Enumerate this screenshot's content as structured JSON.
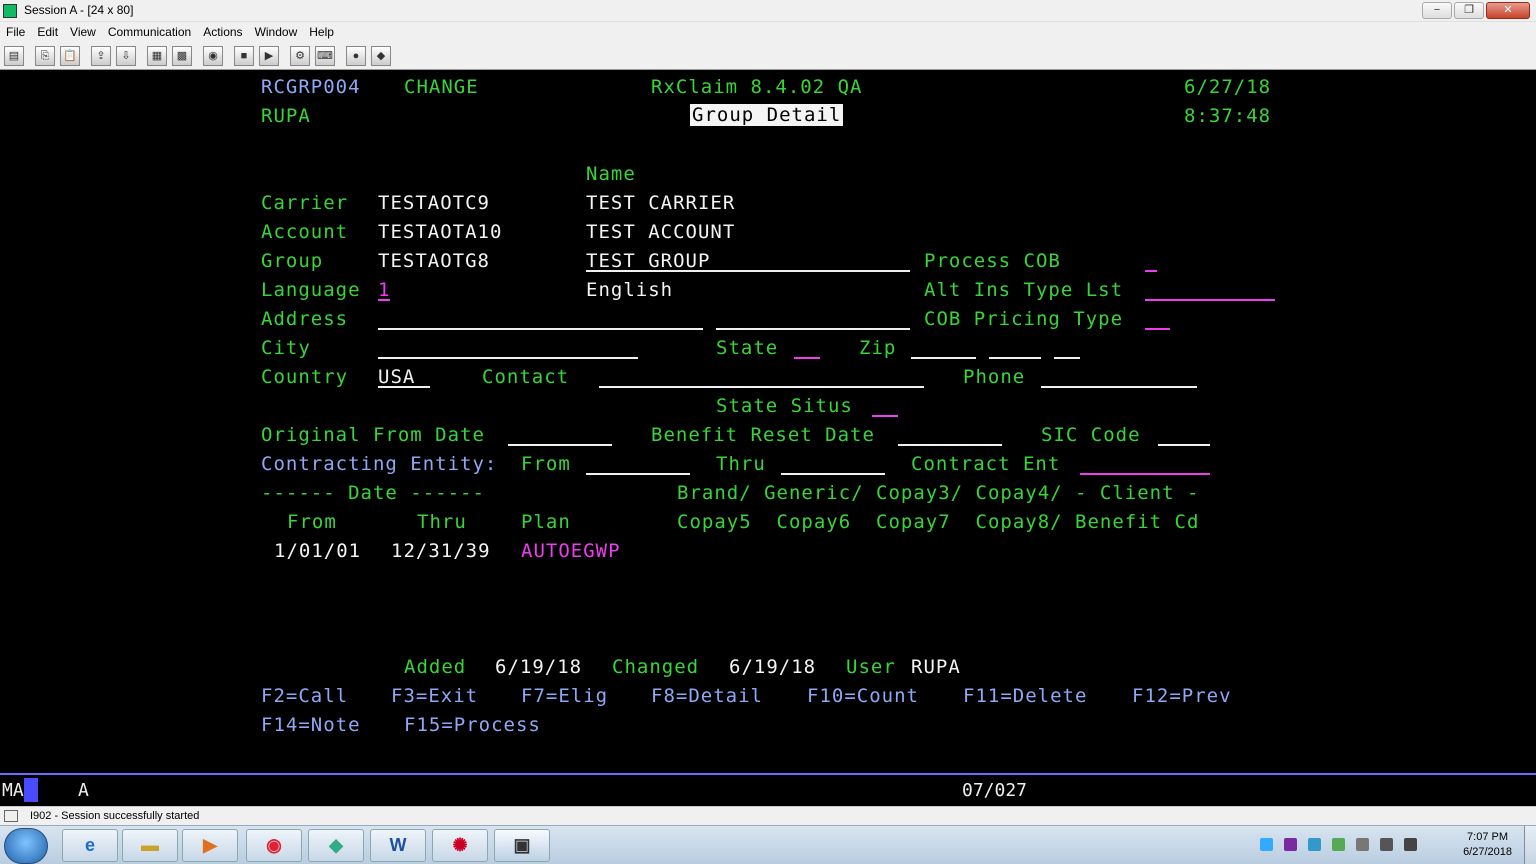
{
  "window": {
    "title": "Session A - [24 x 80]",
    "buttons": [
      "−",
      "❐",
      "✕"
    ]
  },
  "menu": [
    "File",
    "Edit",
    "View",
    "Communication",
    "Actions",
    "Window",
    "Help"
  ],
  "screen": {
    "program_id": "RCGRP004",
    "mode": "CHANGE",
    "system": "RxClaim 8.4.02 QA",
    "date": "6/27/18",
    "user": "RUPA",
    "title": "Group Detail",
    "time": "8:37:48",
    "name_header": "Name",
    "carrier_label": "Carrier",
    "carrier_id": "TESTAOTC9",
    "carrier_name": "TEST CARRIER",
    "account_label": "Account",
    "account_id": "TESTAOTA10",
    "account_name": "TEST ACCOUNT",
    "group_label": "Group",
    "group_id": "TESTAOTG8",
    "group_name": "TEST GROUP",
    "process_cob_label": "Process COB",
    "language_label": "Language",
    "language_code": "1",
    "language_name": "English",
    "alt_ins_label": "Alt Ins Type Lst",
    "address_label": "Address",
    "cob_pricing_label": "COB Pricing Type",
    "city_label": "City",
    "state_label": "State",
    "zip_label": "Zip",
    "country_label": "Country",
    "country_value": "USA",
    "contact_label": "Contact",
    "phone_label": "Phone",
    "state_situs_label": "State Situs",
    "orig_from_label": "Original From Date",
    "benefit_reset_label": "Benefit Reset Date",
    "sic_label": "SIC Code",
    "contracting_label": "Contracting Entity:",
    "from_label": "From",
    "thru_label": "Thru",
    "contract_ent_label": "Contract Ent",
    "date_header": "------ Date ------",
    "copay_header_1": "Brand/ Generic/ Copay3/ Copay4/ - Client -",
    "col_from": "From",
    "col_thru": "Thru",
    "col_plan": "Plan",
    "copay_header_2": "Copay5  Copay6  Copay7  Copay8/ Benefit Cd",
    "row_from": "1/01/01",
    "row_thru": "12/31/39",
    "row_plan": "AUTOEGWP",
    "added_label": "Added",
    "added_value": "6/19/18",
    "changed_label": "Changed",
    "changed_value": "6/19/18",
    "user_label": "User",
    "user_value": "RUPA",
    "fkeys_row1": [
      "F2=Call",
      "F3=Exit",
      "F7=Elig",
      "F8=Detail",
      "F10=Count",
      "F11=Delete",
      "F12=Prev"
    ],
    "fkeys_row2": [
      "F14=Note",
      "F15=Process"
    ]
  },
  "oia": {
    "ma": "MA",
    "a": "A",
    "cursor_pos": "07/027"
  },
  "status": {
    "message": "I902 - Session successfully started"
  },
  "taskbar": {
    "time": "7:07 PM",
    "date": "6/27/2018"
  }
}
